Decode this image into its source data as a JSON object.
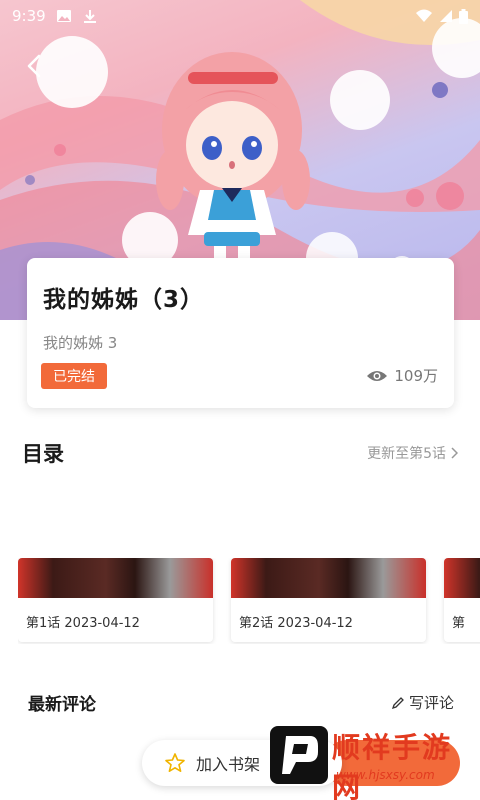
{
  "status_bar": {
    "time": "9:39"
  },
  "comic": {
    "title": "我的姊姊（3）",
    "subtitle": "我的姊姊 3",
    "status_badge": "已完结",
    "views": "109万"
  },
  "toc": {
    "title": "目录",
    "update_text": "更新至第5话"
  },
  "chapters": [
    {
      "label": "第1话 2023-04-12"
    },
    {
      "label": "第2话 2023-04-12"
    },
    {
      "label": "第"
    }
  ],
  "comments": {
    "title": "最新评论",
    "write_label": "写评论"
  },
  "bottom_bar": {
    "add_shelf_label": "加入书架"
  },
  "watermark": {
    "brand": "顺祥手游网",
    "url": "www.hjsxsy.com"
  },
  "colors": {
    "accent": "#f26a3a",
    "watermark": "#e23a1f"
  }
}
